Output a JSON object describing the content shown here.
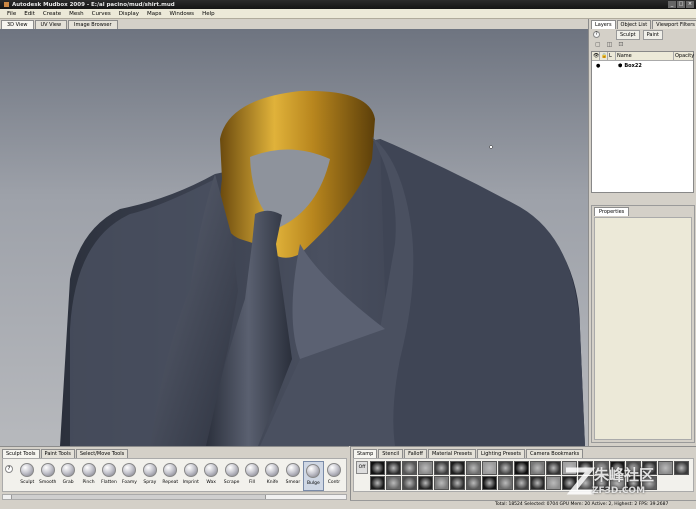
{
  "app": {
    "title": "Autodesk Mudbox 2009 - E:/al pacino/mud/shirt.mud",
    "window_controls": [
      "_",
      "□",
      "×"
    ]
  },
  "menu": [
    "File",
    "Edit",
    "Create",
    "Mesh",
    "Curves",
    "Display",
    "Maps",
    "Windows",
    "Help"
  ],
  "view_tabs": [
    {
      "label": "3D View",
      "active": true
    },
    {
      "label": "UV View",
      "active": false
    },
    {
      "label": "Image Browser",
      "active": false
    }
  ],
  "right_panel": {
    "tabs": [
      {
        "label": "Layers",
        "active": true
      },
      {
        "label": "Object List",
        "active": false
      },
      {
        "label": "Viewport Filters",
        "active": false
      }
    ],
    "help": "?",
    "mode_buttons": [
      "Sculpt",
      "Paint"
    ],
    "icons": [
      "new-layer-icon",
      "duplicate-layer-icon",
      "delete-layer-icon"
    ],
    "layer_columns": [
      "👁",
      "🔒",
      "L",
      "Name",
      "Opacity"
    ],
    "layers": [
      {
        "name": "Box22",
        "visible": true
      }
    ],
    "properties_tab": "Properties"
  },
  "sculpt_shelf": {
    "tabs": [
      {
        "label": "Sculpt Tools",
        "active": true
      },
      {
        "label": "Paint Tools",
        "active": false
      },
      {
        "label": "Select/Move Tools",
        "active": false
      }
    ],
    "help": "?",
    "tools": [
      {
        "label": "Sculpt",
        "icon": "sculpt-tool-icon",
        "active": false
      },
      {
        "label": "Smooth",
        "icon": "smooth-tool-icon",
        "active": false
      },
      {
        "label": "Grab",
        "icon": "grab-tool-icon",
        "active": false
      },
      {
        "label": "Pinch",
        "icon": "pinch-tool-icon",
        "active": false
      },
      {
        "label": "Flatten",
        "icon": "flatten-tool-icon",
        "active": false
      },
      {
        "label": "Foamy",
        "icon": "foamy-tool-icon",
        "active": false
      },
      {
        "label": "Spray",
        "icon": "spray-tool-icon",
        "active": false
      },
      {
        "label": "Repeat",
        "icon": "repeat-tool-icon",
        "active": false
      },
      {
        "label": "Imprint",
        "icon": "imprint-tool-icon",
        "active": false
      },
      {
        "label": "Wax",
        "icon": "wax-tool-icon",
        "active": false
      },
      {
        "label": "Scrape",
        "icon": "scrape-tool-icon",
        "active": false
      },
      {
        "label": "Fill",
        "icon": "fill-tool-icon",
        "active": false
      },
      {
        "label": "Knife",
        "icon": "knife-tool-icon",
        "active": false
      },
      {
        "label": "Smear",
        "icon": "smear-tool-icon",
        "active": false
      },
      {
        "label": "Bulge",
        "icon": "bulge-tool-icon",
        "active": true
      },
      {
        "label": "Contr",
        "icon": "contrast-tool-icon",
        "active": false
      }
    ]
  },
  "stamp_shelf": {
    "tabs": [
      {
        "label": "Stamp",
        "active": true
      },
      {
        "label": "Stencil",
        "active": false
      },
      {
        "label": "Falloff",
        "active": false
      },
      {
        "label": "Material Presets",
        "active": false
      },
      {
        "label": "Lighting Presets",
        "active": false
      },
      {
        "label": "Camera Bookmarks",
        "active": false
      }
    ],
    "off_label": "Off",
    "stamp_colors": [
      "#111",
      "#2a2a2a",
      "#555",
      "#888",
      "#3c3c3c",
      "#1d1d1d",
      "#6e6e6e",
      "#999",
      "#444",
      "#0e0e0e",
      "#777",
      "#333",
      "#a0a0a0",
      "#262626",
      "#5a5a5a",
      "#161616",
      "#4a4a4a",
      "#2f2f2f",
      "#8a8a8a",
      "#3a3a3a",
      "#1a1a1a",
      "#666",
      "#4c4c4c",
      "#222",
      "#7a7a7a",
      "#303030",
      "#585858",
      "#121212",
      "#6a6a6a",
      "#404040",
      "#292929",
      "#8e8e8e",
      "#1e1e1e",
      "#505050",
      "#383838",
      "#737373",
      "#202020",
      "#5e5e5e"
    ]
  },
  "status": {
    "text": "Total: 18524  Selected: 0704 GPU Mem: 20  Active: 2, Highest: 2  FPS: 39.2687"
  },
  "watermark": {
    "line1": "朱峰社区",
    "line2": "ZF3D.COM"
  },
  "colors": {
    "viewport_top": "#6e7480",
    "viewport_bottom": "#b7b9bd",
    "suit": "#3d4352",
    "collar": "#c89a2a"
  }
}
